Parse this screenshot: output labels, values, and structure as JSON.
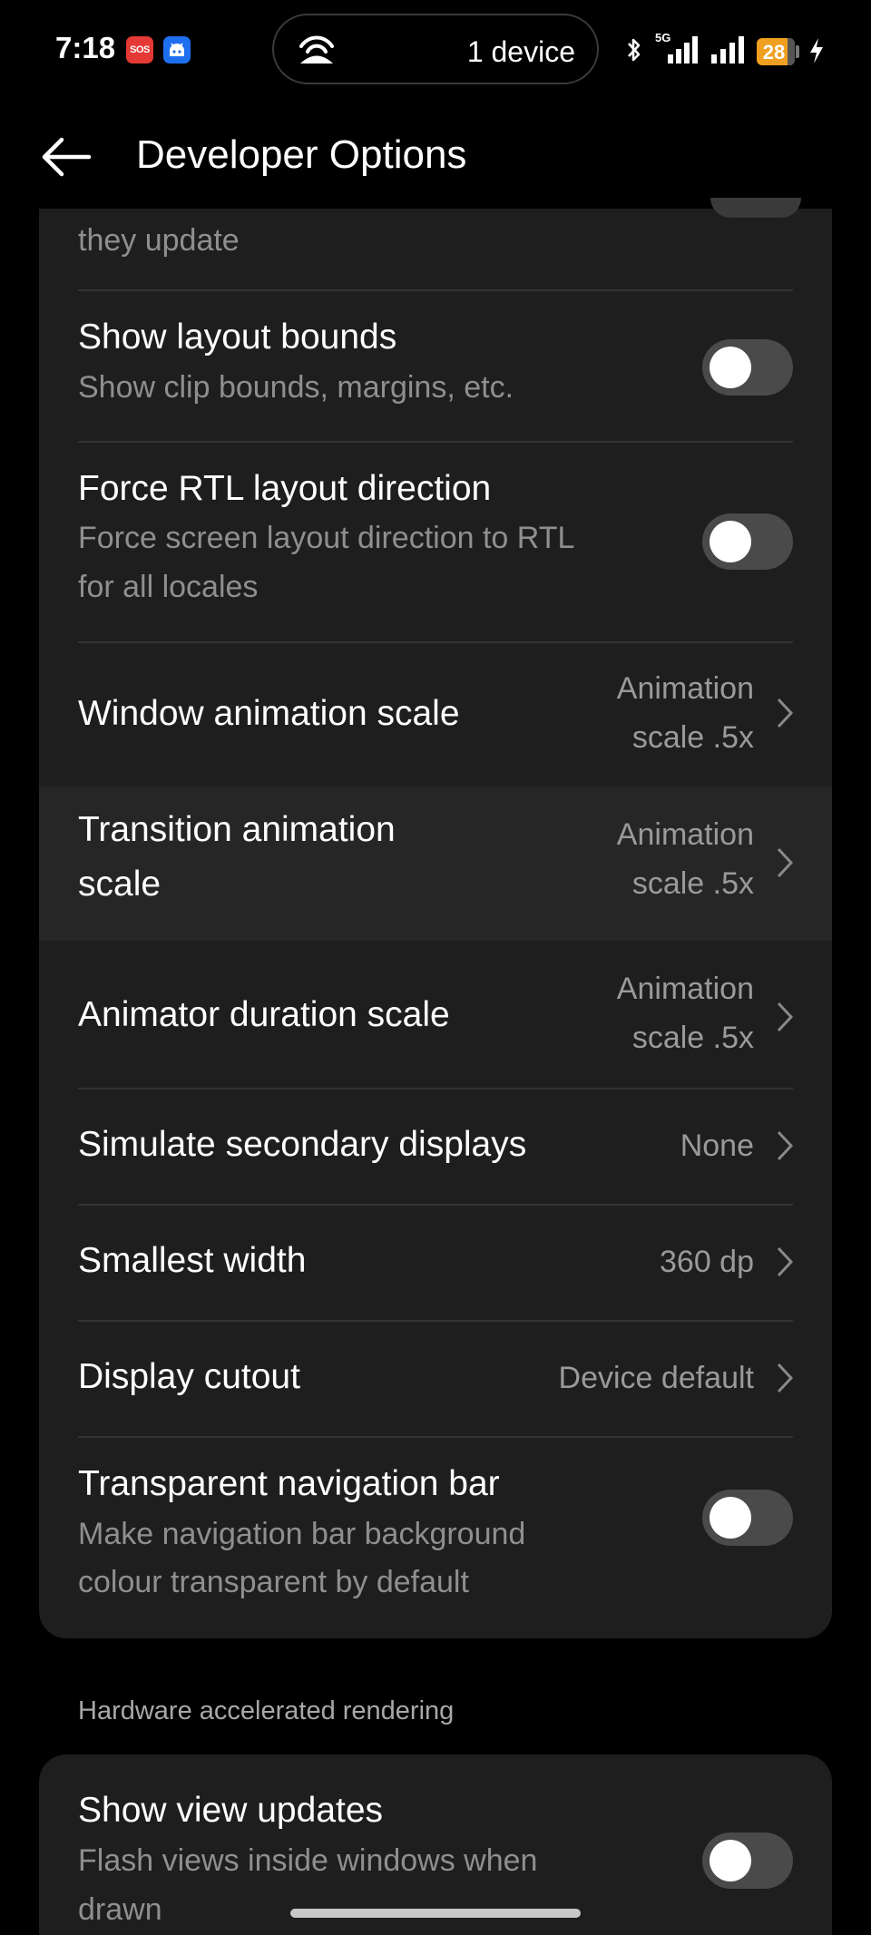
{
  "status_bar": {
    "time": "7:18",
    "sos_label": "SOS",
    "hotspot_text": "1 device",
    "network": "5G",
    "battery": "28"
  },
  "header": {
    "title": "Developer Options"
  },
  "list": {
    "partial_subtitle": "they update",
    "show_layout_bounds": {
      "title": "Show layout bounds",
      "subtitle": "Show clip bounds, margins, etc.",
      "on": false
    },
    "force_rtl": {
      "title": "Force RTL layout direction",
      "subtitle_1": "Force screen layout direction to RTL",
      "subtitle_2": "for all locales",
      "on": false
    },
    "window_animation": {
      "title": "Window animation scale",
      "value_1": "Animation",
      "value_2": "scale .5x"
    },
    "transition_animation": {
      "title_1": "Transition animation",
      "title_2": "scale",
      "value_1": "Animation",
      "value_2": "scale .5x"
    },
    "animator_duration": {
      "title": "Animator duration scale",
      "value_1": "Animation",
      "value_2": "scale .5x"
    },
    "simulate_displays": {
      "title": "Simulate secondary displays",
      "value": "None"
    },
    "smallest_width": {
      "title": "Smallest width",
      "value": "360 dp"
    },
    "display_cutout": {
      "title": "Display cutout",
      "value": "Device default"
    },
    "transparent_nav": {
      "title": "Transparent navigation bar",
      "subtitle_1": "Make navigation bar background",
      "subtitle_2": "colour transparent by default",
      "on": false
    }
  },
  "section_hardware": {
    "label": "Hardware accelerated rendering",
    "show_view_updates": {
      "title": "Show view updates",
      "subtitle_1": "Flash views inside windows when",
      "subtitle_2": "drawn",
      "on": false
    }
  },
  "colors": {
    "background": "#000000",
    "card": "#1e1e1e",
    "toggle_off_track": "#4a4a4a",
    "secondary_text": "#8f8f8f"
  }
}
